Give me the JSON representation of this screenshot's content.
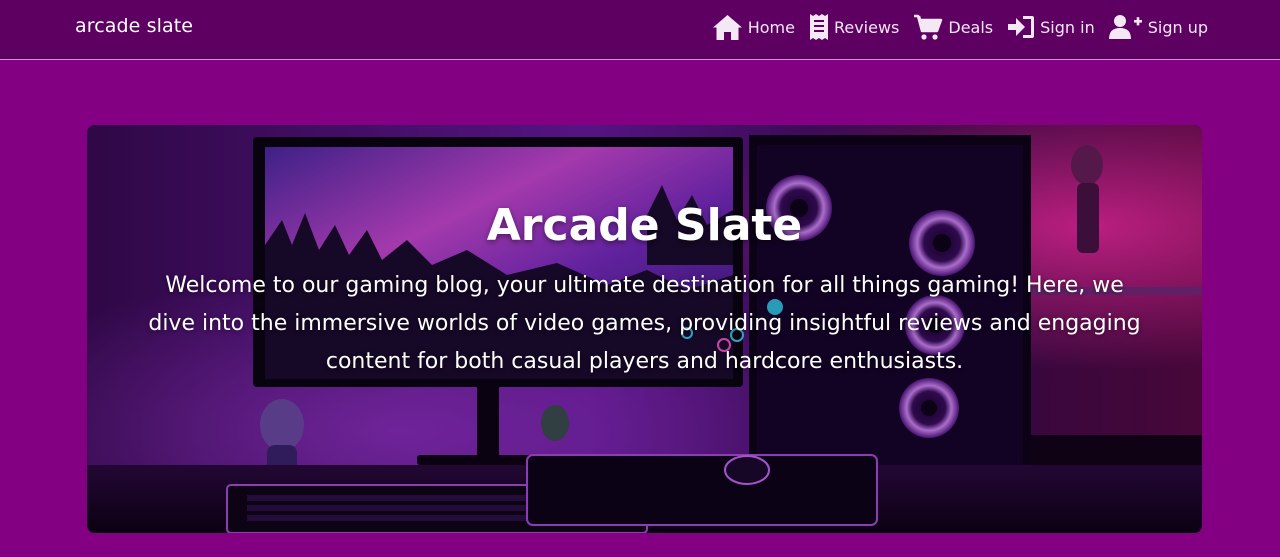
{
  "colors": {
    "page_background": "#830083",
    "navbar_background": "#5e0062",
    "text": "#ffffff"
  },
  "navbar": {
    "brand": "arcade slate",
    "links": [
      {
        "label": "Home",
        "icon": "home-icon"
      },
      {
        "label": "Reviews",
        "icon": "receipt-icon"
      },
      {
        "label": "Deals",
        "icon": "cart-icon"
      },
      {
        "label": "Sign in",
        "icon": "sign-in-icon"
      },
      {
        "label": "Sign up",
        "icon": "user-plus-icon"
      }
    ]
  },
  "hero": {
    "image_description_icon": "gaming-setup-photo",
    "title": "Arcade Slate",
    "text": "Welcome to our gaming blog, your ultimate destination for all things gaming! Here, we dive into the immersive worlds of video games, providing insightful reviews and engaging content for both casual players and hardcore enthusiasts."
  }
}
